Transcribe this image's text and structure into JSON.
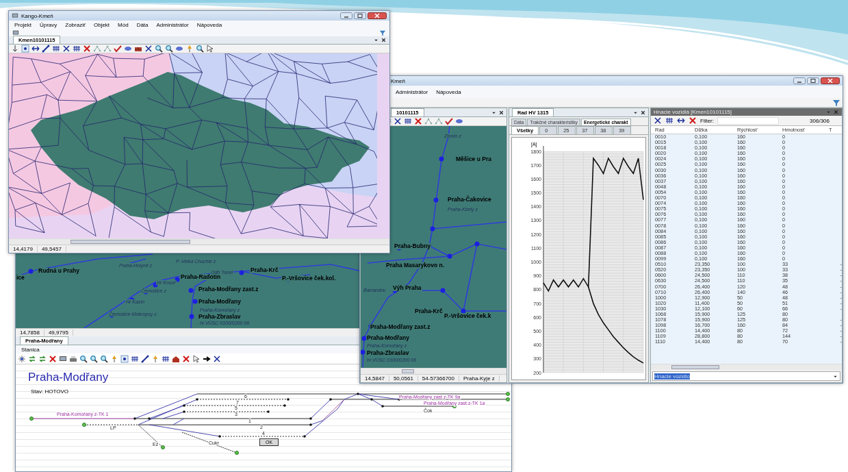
{
  "front_window": {
    "title": "Kango-Kmeň",
    "menu": [
      "Projekt",
      "Úpravy",
      "Zobraziť",
      "Objekt",
      "Mód",
      "Dáta",
      "Administrátor",
      "Nápoveda"
    ],
    "tab": {
      "label": "Kmen10101115",
      "selected": true
    },
    "status": [
      "14,4179",
      "49,5457"
    ]
  },
  "right_window": {
    "title": "Kmeň",
    "menu": [
      "Administrátor",
      "Nápoveda"
    ],
    "map_panel": {
      "tab": {
        "label": "10101115",
        "selected": true
      },
      "labels": [
        {
          "text": "Zlonín z",
          "kind": "stop"
        },
        {
          "text": "Měšice u Pra",
          "kind": "station"
        },
        {
          "text": "Praha-Čakovice",
          "kind": "station"
        },
        {
          "text": "Praha-Kbely z",
          "kind": "stop"
        },
        {
          "text": "Praha-Bubny",
          "kind": "station"
        },
        {
          "text": "Praha Masarykovo n.",
          "kind": "station"
        },
        {
          "text": "Barrandov",
          "kind": "stop"
        },
        {
          "text": "Výh Praha",
          "kind": "station"
        },
        {
          "text": "Praha-Krč",
          "kind": "station"
        },
        {
          "text": "P.-Vršovice ček.k",
          "kind": "station"
        },
        {
          "text": "Praha-Modřany zast.z",
          "kind": "station"
        },
        {
          "text": "Praha-Modřany",
          "kind": "station"
        },
        {
          "text": "Praha-Komořany z",
          "kind": "stop"
        },
        {
          "text": "Praha-Zbraslav",
          "kind": "station"
        },
        {
          "text": "hr.VÚSC 0100/0200 06",
          "kind": "stop"
        }
      ],
      "status": [
        "14,5847",
        "50,0561",
        "54-57366700",
        "Praha-Kyje z"
      ]
    },
    "chart_panel": {
      "tab": {
        "label": "Rad HV 1315",
        "selected": true
      },
      "tabs": [
        {
          "label": "Dáta",
          "selected": false
        },
        {
          "label": "Trakčné charakteristiky",
          "selected": false
        },
        {
          "label": "Energetické charakt",
          "selected": true
        }
      ],
      "subtabs": [
        {
          "label": "Všetky",
          "selected": true
        },
        {
          "label": "0",
          "selected": false
        },
        {
          "label": "25",
          "selected": false
        },
        {
          "label": "37",
          "selected": false
        },
        {
          "label": "38",
          "selected": false
        },
        {
          "label": "39",
          "selected": false
        }
      ],
      "chart_data": {
        "type": "line",
        "ylabel": "[A]",
        "ylim": [
          200,
          1800
        ],
        "yticks": [
          200,
          300,
          400,
          500,
          600,
          700,
          800,
          900,
          1000,
          1100,
          1200,
          1300,
          1400,
          1500,
          1600,
          1700,
          1800
        ],
        "grid": true,
        "series": [
          {
            "color": "#111111",
            "values": [
              850,
              790,
              870,
              820,
              870,
              820,
              870,
              820,
              880,
              820,
              1750,
              1700,
              1640,
              1750,
              1690,
              1640,
              1750,
              1690,
              1640,
              1750,
              1450
            ]
          },
          {
            "color": "#111111",
            "values": [
              null,
              null,
              null,
              null,
              null,
              null,
              null,
              null,
              null,
              820,
              700,
              620,
              560,
              510,
              460,
              420,
              380,
              345,
              315,
              290,
              270
            ]
          }
        ]
      }
    },
    "table_panel": {
      "title": "Hnacie vozidlá [Kmen10101115]",
      "filter_label": "Filter:",
      "count": "306/306",
      "columns": [
        "Rad",
        "Dĺžka",
        "Rýchlosť",
        "Hmotnosť",
        "T"
      ],
      "rows": [
        [
          "0010",
          "0,100",
          "160",
          "0"
        ],
        [
          "0015",
          "0,100",
          "160",
          "0"
        ],
        [
          "0018",
          "0,100",
          "160",
          "0"
        ],
        [
          "0020",
          "0,100",
          "160",
          "0"
        ],
        [
          "0024",
          "0,100",
          "160",
          "0"
        ],
        [
          "0025",
          "0,100",
          "160",
          "0"
        ],
        [
          "0030",
          "0,100",
          "160",
          "0"
        ],
        [
          "0036",
          "0,100",
          "160",
          "0"
        ],
        [
          "0037",
          "0,100",
          "160",
          "0"
        ],
        [
          "0048",
          "0,100",
          "160",
          "0"
        ],
        [
          "0054",
          "0,100",
          "160",
          "0"
        ],
        [
          "0070",
          "0,100",
          "160",
          "0"
        ],
        [
          "0074",
          "0,100",
          "160",
          "0"
        ],
        [
          "0075",
          "0,100",
          "160",
          "0"
        ],
        [
          "0076",
          "0,100",
          "160",
          "0"
        ],
        [
          "0077",
          "0,100",
          "160",
          "0"
        ],
        [
          "0078",
          "0,100",
          "160",
          "0"
        ],
        [
          "0084",
          "0,100",
          "160",
          "0"
        ],
        [
          "0085",
          "0,100",
          "160",
          "0"
        ],
        [
          "0086",
          "0,100",
          "160",
          "0"
        ],
        [
          "0087",
          "0,100",
          "160",
          "0"
        ],
        [
          "0088",
          "0,100",
          "160",
          "0"
        ],
        [
          "0099",
          "0,100",
          "160",
          "0"
        ],
        [
          "0510",
          "23,350",
          "100",
          "33",
          "-"
        ],
        [
          "0520",
          "23,350",
          "100",
          "33",
          "-"
        ],
        [
          "0600",
          "24,500",
          "110",
          "38",
          "-"
        ],
        [
          "0630",
          "24,500",
          "110",
          "35",
          "-"
        ],
        [
          "0700",
          "26,400",
          "120",
          "48",
          "-"
        ],
        [
          "0710",
          "26,400",
          "140",
          "46",
          "-"
        ],
        [
          "1000",
          "12,900",
          "50",
          "48",
          "-"
        ],
        [
          "1020",
          "11,400",
          "50",
          "51",
          "-"
        ],
        [
          "1030",
          "12,100",
          "60",
          "66",
          "-"
        ],
        [
          "1068",
          "15,900",
          "125",
          "80"
        ],
        [
          "1078",
          "15,900",
          "125",
          "80",
          "-"
        ],
        [
          "1098",
          "16,700",
          "160",
          "84",
          "-"
        ],
        [
          "1100",
          "14,400",
          "80",
          "72",
          "-"
        ],
        [
          "1109",
          "28,800",
          "80",
          "144",
          "-"
        ],
        [
          "1110",
          "14,400",
          "80",
          "70",
          "-"
        ]
      ],
      "selector": "Hnacie vozidlo"
    }
  },
  "back_window": {
    "map_labels": [
      {
        "text": "ice",
        "kind": "station"
      },
      {
        "text": "Rudná u Prahy",
        "kind": "station"
      },
      {
        "text": "Praha-Holyně z",
        "kind": "stop"
      },
      {
        "text": "P.-Velká Chuchle z",
        "kind": "stop"
      },
      {
        "text": "Praha-Radotín",
        "kind": "station"
      },
      {
        "text": "Hr Kosoř",
        "kind": "stop"
      },
      {
        "text": "Černošice z",
        "kind": "stop"
      },
      {
        "text": "Hr Kazín",
        "kind": "stop"
      },
      {
        "text": "Černošice-Mokropsy z",
        "kind": "stop"
      },
      {
        "text": "Odb Tunel",
        "kind": "stop"
      },
      {
        "text": "Praha-Krč",
        "kind": "station"
      },
      {
        "text": "P.-Vršovice ček.kol.",
        "kind": "station"
      },
      {
        "text": "Praha-Modřany zast.z",
        "kind": "station"
      },
      {
        "text": "Praha-Modřany",
        "kind": "station"
      },
      {
        "text": "Praha-Komořany z",
        "kind": "stop"
      },
      {
        "text": "Praha-Zbraslav",
        "kind": "station"
      },
      {
        "text": "hr.VÚSC 0100/0200 06",
        "kind": "stop"
      }
    ],
    "status": [
      "14,7858",
      "49,9795"
    ],
    "tab": {
      "label": "Praha-Modřany",
      "selected": true
    },
    "menu": [
      "Stanica"
    ],
    "station_name": "Praha-Modřany",
    "state": "Stav: HOTOVO",
    "track_labels": [
      {
        "text": "6",
        "kind": "track"
      },
      {
        "text": "7",
        "kind": "track"
      },
      {
        "text": "5",
        "kind": "track"
      },
      {
        "text": "3",
        "kind": "track"
      },
      {
        "text": "1",
        "kind": "track"
      },
      {
        "text": "2",
        "kind": "track"
      },
      {
        "text": "4",
        "kind": "track"
      },
      {
        "text": "Praha-Komořany z-TK 1",
        "kind": "end"
      },
      {
        "text": "Praha-Modřany zast.z-TK 9a",
        "kind": "end"
      },
      {
        "text": "Praha-Modřany zast.z-TK 1a",
        "kind": "end"
      },
      {
        "text": "Čok",
        "kind": "track"
      },
      {
        "text": "LP",
        "kind": "track"
      },
      {
        "text": "Ez",
        "kind": "track"
      },
      {
        "text": "Cukr",
        "kind": "track"
      }
    ],
    "ok_button": "OK"
  }
}
